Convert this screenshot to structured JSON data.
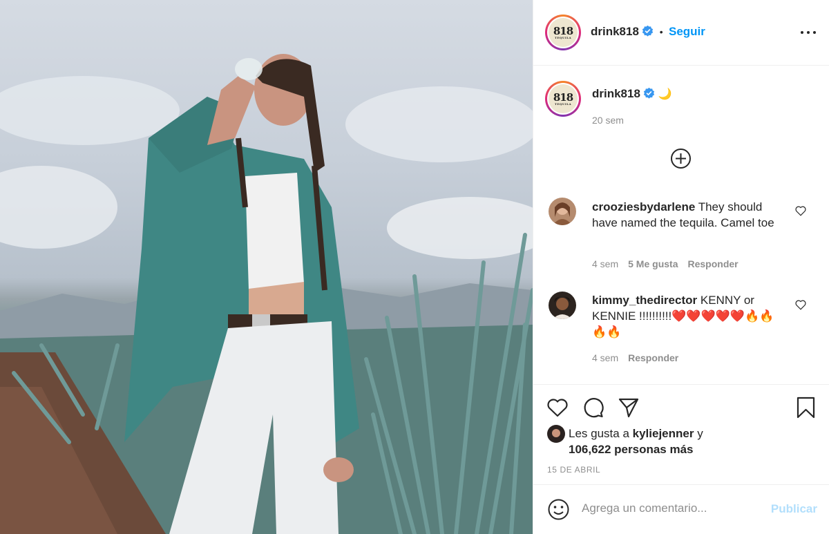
{
  "header": {
    "username": "drink818",
    "follow_label": "Seguir",
    "logo_text": "818",
    "logo_sub": "TEQUILA"
  },
  "caption": {
    "username": "drink818",
    "emoji": "🌙",
    "time": "20 sem"
  },
  "comments": [
    {
      "username": "croozies​bydarlene",
      "text": "They should have named the tequila. Camel toe",
      "time": "4 sem",
      "likes": "5 Me gusta",
      "reply": "Responder"
    },
    {
      "username": "kimmy_thedirector",
      "text": "KENNY or KENNIE !!!!!!!!!!❤️❤️❤️❤️❤️🔥🔥🔥🔥",
      "time": "4 sem",
      "reply": "Responder"
    }
  ],
  "likes": {
    "prefix": "Les gusta a",
    "user": "kyliejenner",
    "conj": "y",
    "count": "106,622 personas más"
  },
  "date": "15 DE ABRIL",
  "add_comment": {
    "placeholder": "Agrega un comentario...",
    "publish_label": "Publicar"
  },
  "colors": {
    "link": "#0095f6",
    "muted": "#8e8e8e",
    "publish_disabled": "#b2dffc"
  }
}
